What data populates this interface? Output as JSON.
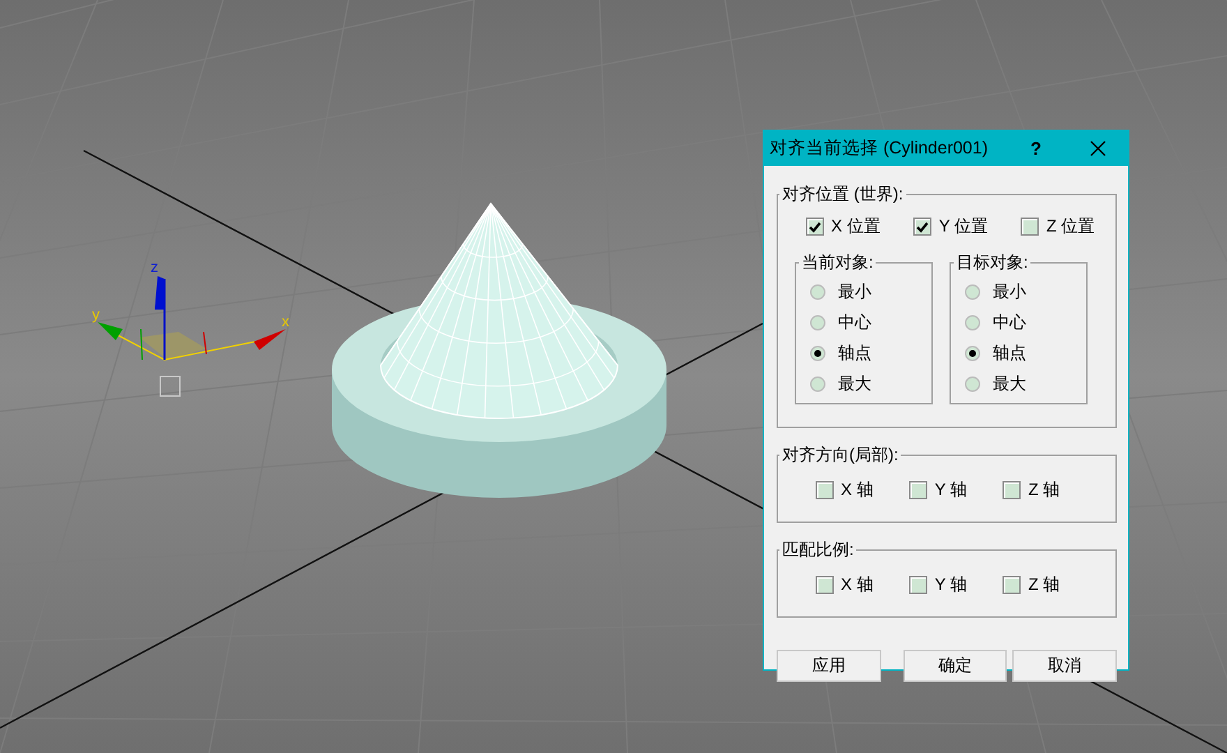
{
  "viewport": {
    "gizmo_labels": [
      "x",
      "y",
      "z"
    ]
  },
  "dialog": {
    "title": "对齐当前选择 (Cylinder001)",
    "help": "?",
    "position": {
      "title": "对齐位置 (世界):",
      "axes": [
        {
          "label": "X 位置",
          "checked": true
        },
        {
          "label": "Y 位置",
          "checked": true
        },
        {
          "label": "Z 位置",
          "checked": false
        }
      ],
      "current": {
        "title": "当前对象:",
        "options": [
          {
            "label": "最小",
            "selected": false
          },
          {
            "label": "中心",
            "selected": false
          },
          {
            "label": "轴点",
            "selected": true
          },
          {
            "label": "最大",
            "selected": false
          }
        ]
      },
      "target": {
        "title": "目标对象:",
        "options": [
          {
            "label": "最小",
            "selected": false
          },
          {
            "label": "中心",
            "selected": false
          },
          {
            "label": "轴点",
            "selected": true
          },
          {
            "label": "最大",
            "selected": false
          }
        ]
      }
    },
    "orientation": {
      "title": "对齐方向(局部):",
      "axes": [
        {
          "label": "X 轴",
          "checked": false
        },
        {
          "label": "Y 轴",
          "checked": false
        },
        {
          "label": "Z 轴",
          "checked": false
        }
      ]
    },
    "scale": {
      "title": "匹配比例:",
      "axes": [
        {
          "label": "X 轴",
          "checked": false
        },
        {
          "label": "Y 轴",
          "checked": false
        },
        {
          "label": "Z 轴",
          "checked": false
        }
      ]
    },
    "buttons": [
      "应用",
      "确定",
      "取消"
    ]
  }
}
